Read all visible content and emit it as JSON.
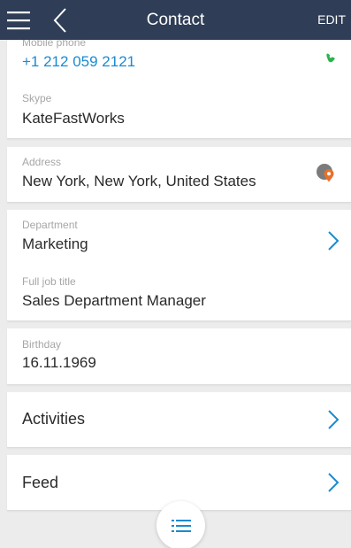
{
  "header": {
    "title": "Contact",
    "edit_label": "EDIT",
    "background": "#2f3e56"
  },
  "contact": {
    "mobile": {
      "label": "Mobile phone",
      "value": "+1 212 059 2121"
    },
    "skype": {
      "label": "Skype",
      "value": "KateFastWorks"
    },
    "address": {
      "label": "Address",
      "value": "New York, New York, United States"
    },
    "department": {
      "label": "Department",
      "value": "Marketing"
    },
    "job_title": {
      "label": "Full job title",
      "value": "Sales Department Manager"
    },
    "birthday": {
      "label": "Birthday",
      "value": "16.11.1969"
    }
  },
  "sections": {
    "activities": "Activities",
    "feed": "Feed"
  },
  "icons": {
    "menu": "hamburger-menu-icon",
    "back": "chevron-left-icon",
    "call": "phone-icon",
    "map": "map-pin-icon",
    "chevron": "chevron-right-icon",
    "fab": "list-icon"
  },
  "colors": {
    "accent": "#1b8ad0",
    "phone_green": "#2bb24c",
    "map_orange": "#e8702a"
  }
}
